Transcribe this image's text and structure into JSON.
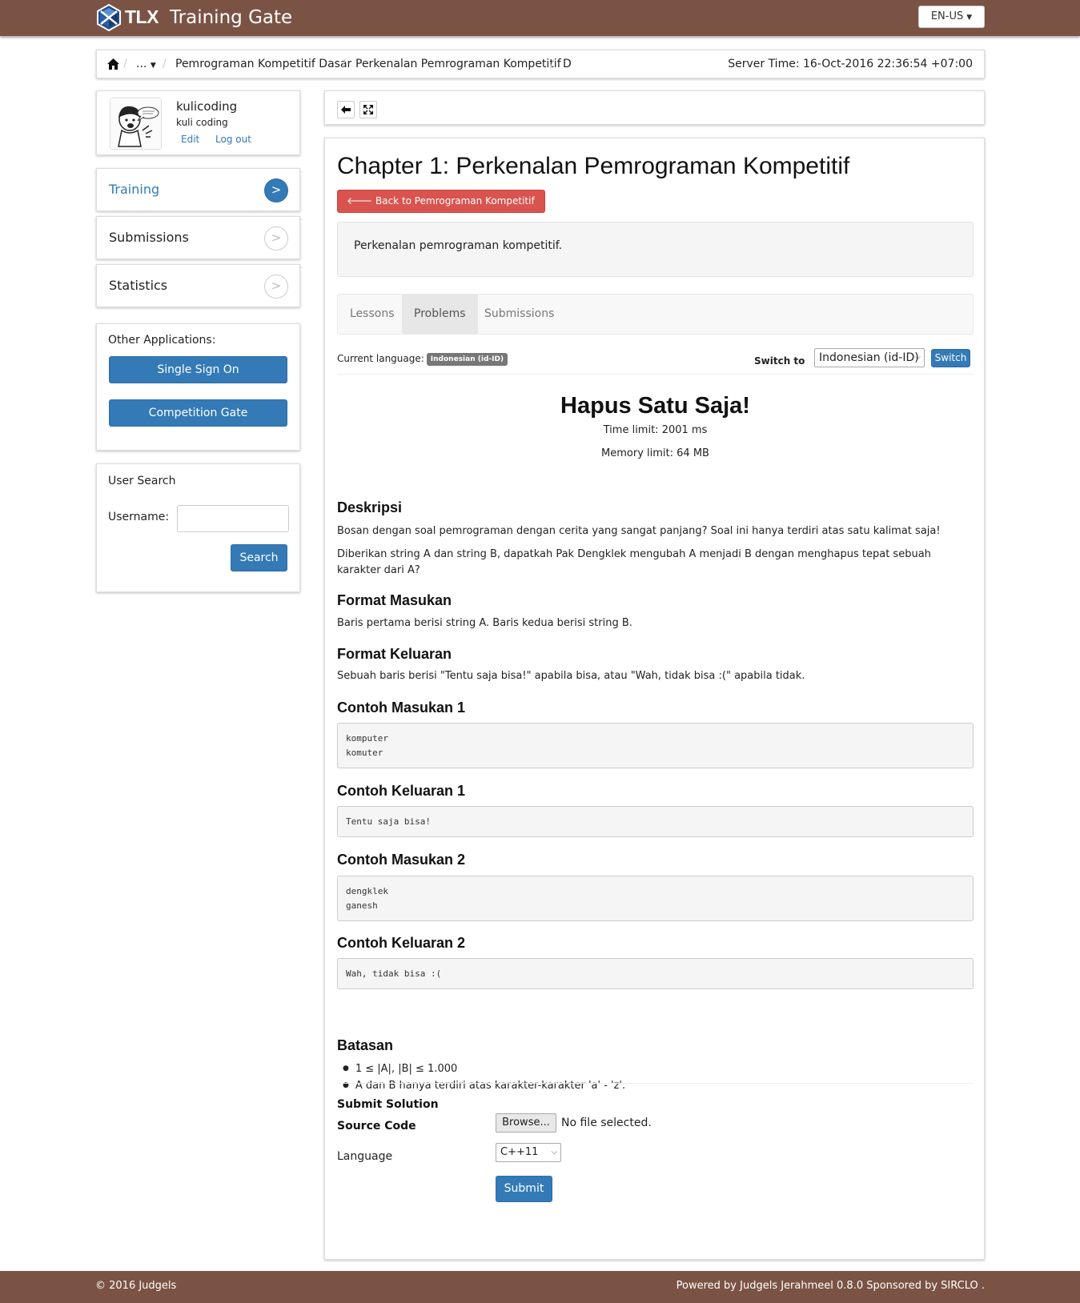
{
  "header": {
    "logo_text": "TLX",
    "app_title": "Training Gate",
    "language": "EN-US"
  },
  "breadcrumb": {
    "ellipsis": "...",
    "items": [
      "Pemrograman Kompetitif Dasar",
      "Perkenalan Pemrograman Kompetitif",
      "D"
    ],
    "server_time": "Server Time: 16-Oct-2016 22:36:54 +07:00"
  },
  "profile": {
    "username": "kulicoding",
    "real_name": "kuli coding",
    "edit": "Edit",
    "logout": "Log out"
  },
  "sidebar": {
    "menu": [
      {
        "label": "Training",
        "active": true
      },
      {
        "label": "Submissions",
        "active": false
      },
      {
        "label": "Statistics",
        "active": false
      }
    ],
    "menu_arrow": ">",
    "other_apps_title": "Other Applications:",
    "other_apps": [
      "Single Sign On",
      "Competition Gate"
    ],
    "user_search": {
      "title": "User Search",
      "label": "Username:",
      "value": "",
      "button": "Search"
    }
  },
  "chapter": {
    "title": "Chapter 1: Perkenalan Pemrograman Kompetitif",
    "back_button": "Back to Pemrograman Kompetitif Dasar",
    "description": "Perkenalan pemrograman kompetitif.",
    "tabs": [
      "Lessons",
      "Problems",
      "Submissions"
    ],
    "active_tab": "Problems"
  },
  "language_bar": {
    "current_label": "Current language:",
    "current_badge": "Indonesian (id-ID)",
    "switch_label": "Switch to",
    "switch_value": "Indonesian (id-ID)",
    "switch_button": "Switch"
  },
  "problem": {
    "title": "Hapus Satu Saja!",
    "time_limit": "Time limit: 2001 ms",
    "memory_limit": "Memory limit: 64 MB",
    "desc_heading": "Deskripsi",
    "desc_p1": "Bosan dengan soal pemrograman dengan cerita yang sangat panjang? Soal ini hanya terdiri atas satu kalimat saja!",
    "desc_p2": "Diberikan string A dan string B, dapatkah Pak Dengklek mengubah A menjadi B dengan menghapus tepat sebuah karakter dari A?",
    "input_heading": "Format Masukan",
    "input_text": "Baris pertama berisi string A. Baris kedua berisi string B.",
    "output_heading": "Format Keluaran",
    "output_text": "Sebuah baris berisi \"Tentu saja bisa!\" apabila bisa, atau \"Wah, tidak bisa :(\" apabila tidak.",
    "samples": [
      {
        "heading": "Contoh Masukan 1",
        "content": "komputer\nkomuter"
      },
      {
        "heading": "Contoh Keluaran 1",
        "content": "Tentu saja bisa!"
      },
      {
        "heading": "Contoh Masukan 2",
        "content": "dengklek\nganesh"
      },
      {
        "heading": "Contoh Keluaran 2",
        "content": "Wah, tidak bisa :("
      }
    ],
    "constraints_heading": "Batasan",
    "constraints": [
      "1 ≤ |A|, |B| ≤ 1.000",
      "A dan B hanya terdiri atas karakter-karakter 'a' - 'z'."
    ]
  },
  "submit": {
    "title": "Submit Solution",
    "source_label": "Source Code",
    "browse": "Browse...",
    "file_status": "No file selected.",
    "language_label": "Language",
    "language_value": "C++11",
    "button": "Submit"
  },
  "footer": {
    "left": "© 2016 Judgels",
    "right": "Powered by Judgels Jerahmeel 0.8.0 Sponsored by SIRCLO ."
  },
  "colors": {
    "brand": "#7b5345",
    "primary": "#337ab7",
    "danger": "#d9534f"
  }
}
